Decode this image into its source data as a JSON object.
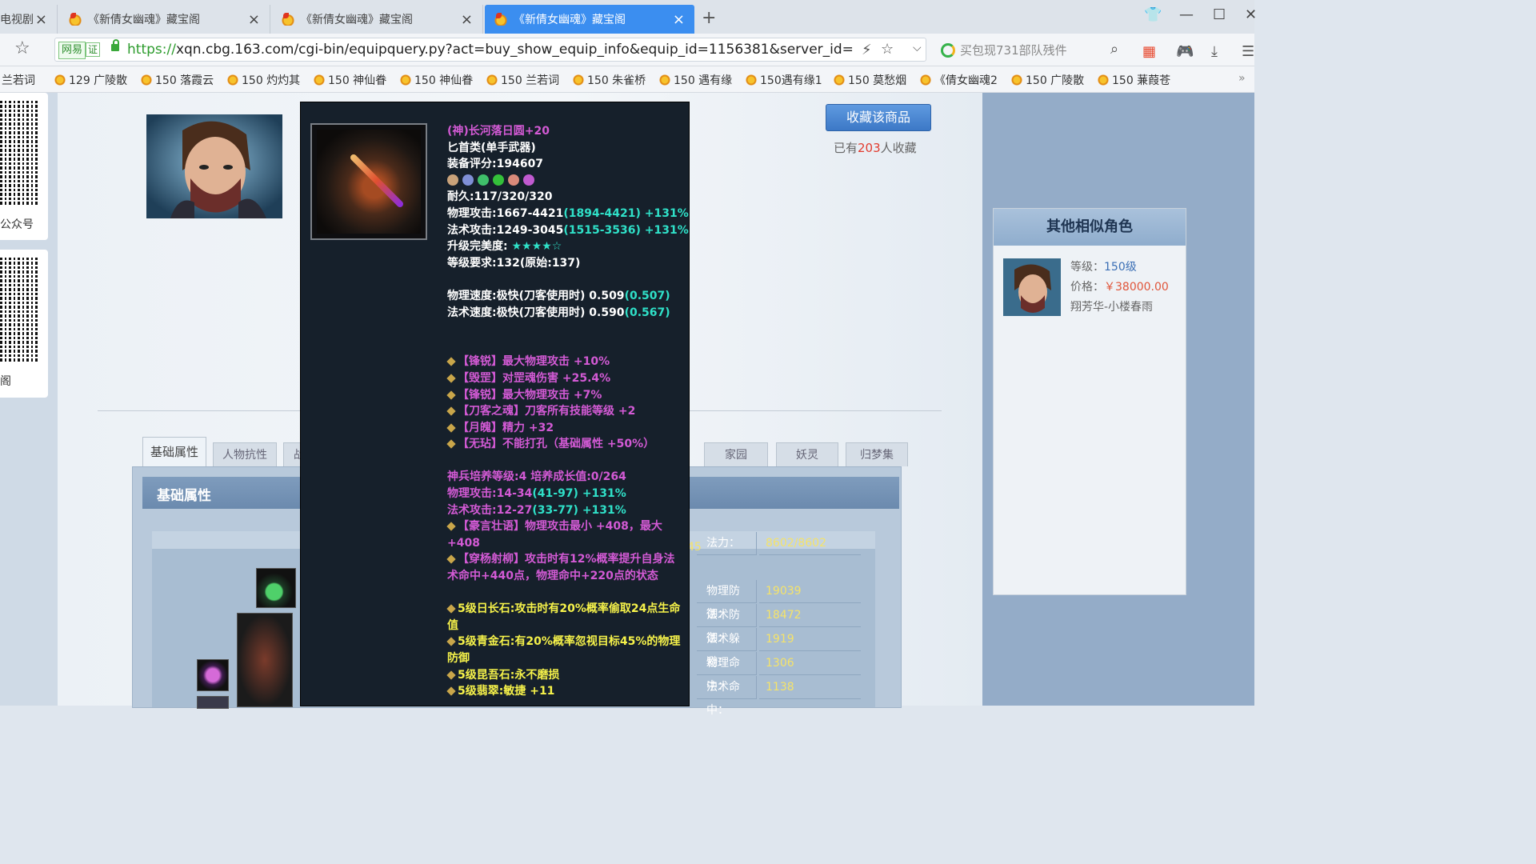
{
  "browser": {
    "tabs": [
      {
        "title": "电视剧",
        "active": false
      },
      {
        "title": "《新倩女幽魂》藏宝阁",
        "active": false
      },
      {
        "title": "《新倩女幽魂》藏宝阁",
        "active": false
      },
      {
        "title": "《新倩女幽魂》藏宝阁",
        "active": true
      }
    ],
    "url_prefix": "https://",
    "url_rest": "xqn.cbg.163.com/cgi-bin/equipquery.py?act=buy_show_equip_info&equip_id=1156381&server_id=",
    "netease_badge": "网易",
    "cert_badge": "证",
    "search_placeholder": "买包现731部队残件",
    "accent_color": "#3b8ef0"
  },
  "bookmarks": [
    "兰若词",
    "129 广陵散",
    "150 落霞云",
    "150 灼灼其",
    "150 神仙眷",
    "150 神仙眷",
    "150 兰若词",
    "150 朱雀桥",
    "150 遇有缘",
    "150遇有缘1",
    "150 莫愁烟",
    "《倩女幽魂2",
    "150 广陵散",
    "150 蒹葭苍"
  ],
  "sidebar_qr": {
    "label1": "公众号",
    "label2": "阁"
  },
  "header": {
    "favorite_button": "收藏该商品",
    "favorite_prefix": "已有",
    "favorite_count": "203",
    "favorite_suffix": "人收藏"
  },
  "tabs": {
    "basic": "基础属性",
    "resist": "人物抗性",
    "battle": "战",
    "home": "家园",
    "spirit": "妖灵",
    "dream": "归梦集"
  },
  "attr_panel": {
    "title": "基础属性",
    "partial_value": "45",
    "stats": [
      {
        "key": "法力：",
        "value": "8602/8602"
      },
      {
        "key": "物理防御：",
        "value": "19039"
      },
      {
        "key": "法术防御：",
        "value": "18472"
      },
      {
        "key": "法术躲避：",
        "value": "1919"
      },
      {
        "key": "物理命中：",
        "value": "1306"
      },
      {
        "key": "法术命中：",
        "value": "1138"
      }
    ]
  },
  "tooltip": {
    "name": "(神)长河落日圆+20",
    "type": "匕首类(单手武器)",
    "score": "装备评分:194607",
    "durability": "耐久:117/320/320",
    "phys_atk": "物理攻击:1667-4421",
    "phys_atk_bonus": "(1894-4421) +131%",
    "mag_atk": "法术攻击:1249-3045",
    "mag_atk_bonus": "(1515-3536) +131%",
    "upgrade_label": "升级完美度: ",
    "upgrade_stars": "★★★★☆",
    "level_req": "等级要求:132(原始:137)",
    "phys_speed": "物理速度:极快(刀客使用时) 0.509",
    "phys_speed_bonus": "(0.507)",
    "mag_speed": "法术速度:极快(刀客使用时) 0.590",
    "mag_speed_bonus": "(0.567)",
    "affixes": [
      "【锋锐】最大物理攻击 +10%",
      "【毁罡】对罡魂伤害 +25.4%",
      "【锋锐】最大物理攻击 +7%",
      "【刀客之魂】刀客所有技能等级 +2",
      "【月魄】精力 +32",
      "【无玷】不能打孔（基础属性 +50%）"
    ],
    "divine": "神兵培养等级:4 培养成长值:0/264",
    "divine_phys": "物理攻击:14-34",
    "divine_phys_bonus": "(41-97) +131%",
    "divine_mag": "法术攻击:12-27",
    "divine_mag_bonus": "(33-77) +131%",
    "divine_skills": [
      "【豪言壮语】物理攻击最小 +408，最大+408",
      "【穿杨射柳】攻击时有12%概率提升自身法术命中+440点，物理命中+220点的状态"
    ],
    "gems": [
      "5级日长石:攻击时有20%概率偷取24点生命值",
      "5级青金石:有20%概率忽视目标45%的物理防御",
      "5级昆吾石:永不磨损",
      "5级翡翠:敏捷 +11"
    ],
    "gem_colors": [
      "#c9a27a",
      "#7f8fd6",
      "#3fbf6a",
      "#34c03a",
      "#d98a7a",
      "#c05ad0"
    ]
  },
  "similar": {
    "title": "其他相似角色",
    "level_label": "等级：",
    "level_value": "150级",
    "price_label": "价格：",
    "price_value": "￥38000.00",
    "server": "翔芳华-小楼春雨"
  }
}
